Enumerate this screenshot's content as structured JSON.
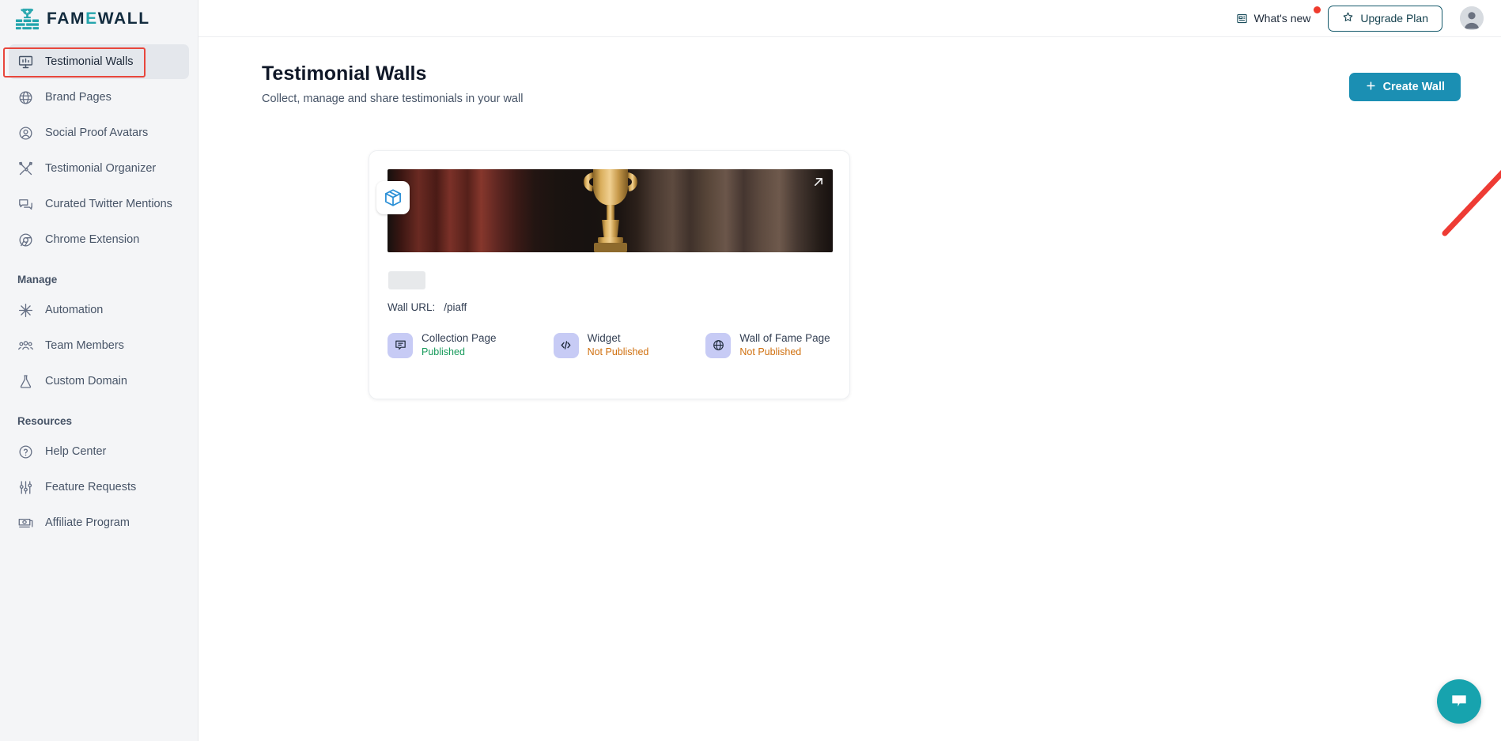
{
  "brand": {
    "name_prefix": "FAM",
    "name_accent": "E",
    "name_suffix": "WALL",
    "logo_icon": "trophy-wall-logo",
    "accent_color": "#24a5ad",
    "wordmark_color": "#122b3e"
  },
  "topbar": {
    "whats_new_label": "What's new",
    "whats_new_icon": "news-icon",
    "has_notification_dot": true,
    "upgrade_label": "Upgrade Plan",
    "upgrade_icon": "star-icon",
    "avatar_icon": "user-avatar",
    "notification_color": "#ef3b2d",
    "upgrade_border_color": "#14596b"
  },
  "sidebar": {
    "items": [
      {
        "label": "Testimonial Walls",
        "icon": "presentation-chart-icon",
        "active": true
      },
      {
        "label": "Brand Pages",
        "icon": "globe-grid-icon",
        "active": false
      },
      {
        "label": "Social Proof Avatars",
        "icon": "user-circle-icon",
        "active": false
      },
      {
        "label": "Testimonial Organizer",
        "icon": "tools-icon",
        "active": false
      },
      {
        "label": "Curated Twitter Mentions",
        "icon": "chat-bubbles-icon",
        "active": false
      },
      {
        "label": "Chrome Extension",
        "icon": "chrome-icon",
        "active": false
      }
    ],
    "manage_section": {
      "title": "Manage",
      "items": [
        {
          "label": "Automation",
          "icon": "sparkle-gear-icon"
        },
        {
          "label": "Team Members",
          "icon": "users-group-icon"
        },
        {
          "label": "Custom Domain",
          "icon": "flask-icon"
        }
      ]
    },
    "resources_section": {
      "title": "Resources",
      "items": [
        {
          "label": "Help Center",
          "icon": "question-circle-icon"
        },
        {
          "label": "Feature Requests",
          "icon": "sliders-icon"
        },
        {
          "label": "Affiliate Program",
          "icon": "money-card-icon"
        }
      ]
    },
    "highlight_color": "#e8463c"
  },
  "main": {
    "title": "Testimonial Walls",
    "subtitle": "Collect, manage and share testimonials in your wall",
    "create_wall_label": "Create Wall",
    "create_wall_icon": "plus-icon",
    "create_wall_color": "#1b8fb3",
    "annotation_arrow_color": "#ee3b34"
  },
  "wall_card": {
    "banner_icon": "trophy-image",
    "expand_icon": "arrow-up-right-icon",
    "badge_icon": "box-package-icon",
    "name_placeholder": "",
    "url_label": "Wall URL:",
    "url_value": "/piaff",
    "statuses": [
      {
        "name": "Collection Page",
        "state": "Published",
        "published": true,
        "icon": "chat-square-icon"
      },
      {
        "name": "Widget",
        "state": "Not Published",
        "published": false,
        "icon": "code-brackets-icon"
      },
      {
        "name": "Wall of Fame Page",
        "state": "Not Published",
        "published": false,
        "icon": "globe-icon"
      }
    ],
    "published_color": "#179a5b",
    "unpublished_color": "#d0700f"
  },
  "chat": {
    "icon": "chat-bubble-icon",
    "color": "#17a3ae"
  }
}
